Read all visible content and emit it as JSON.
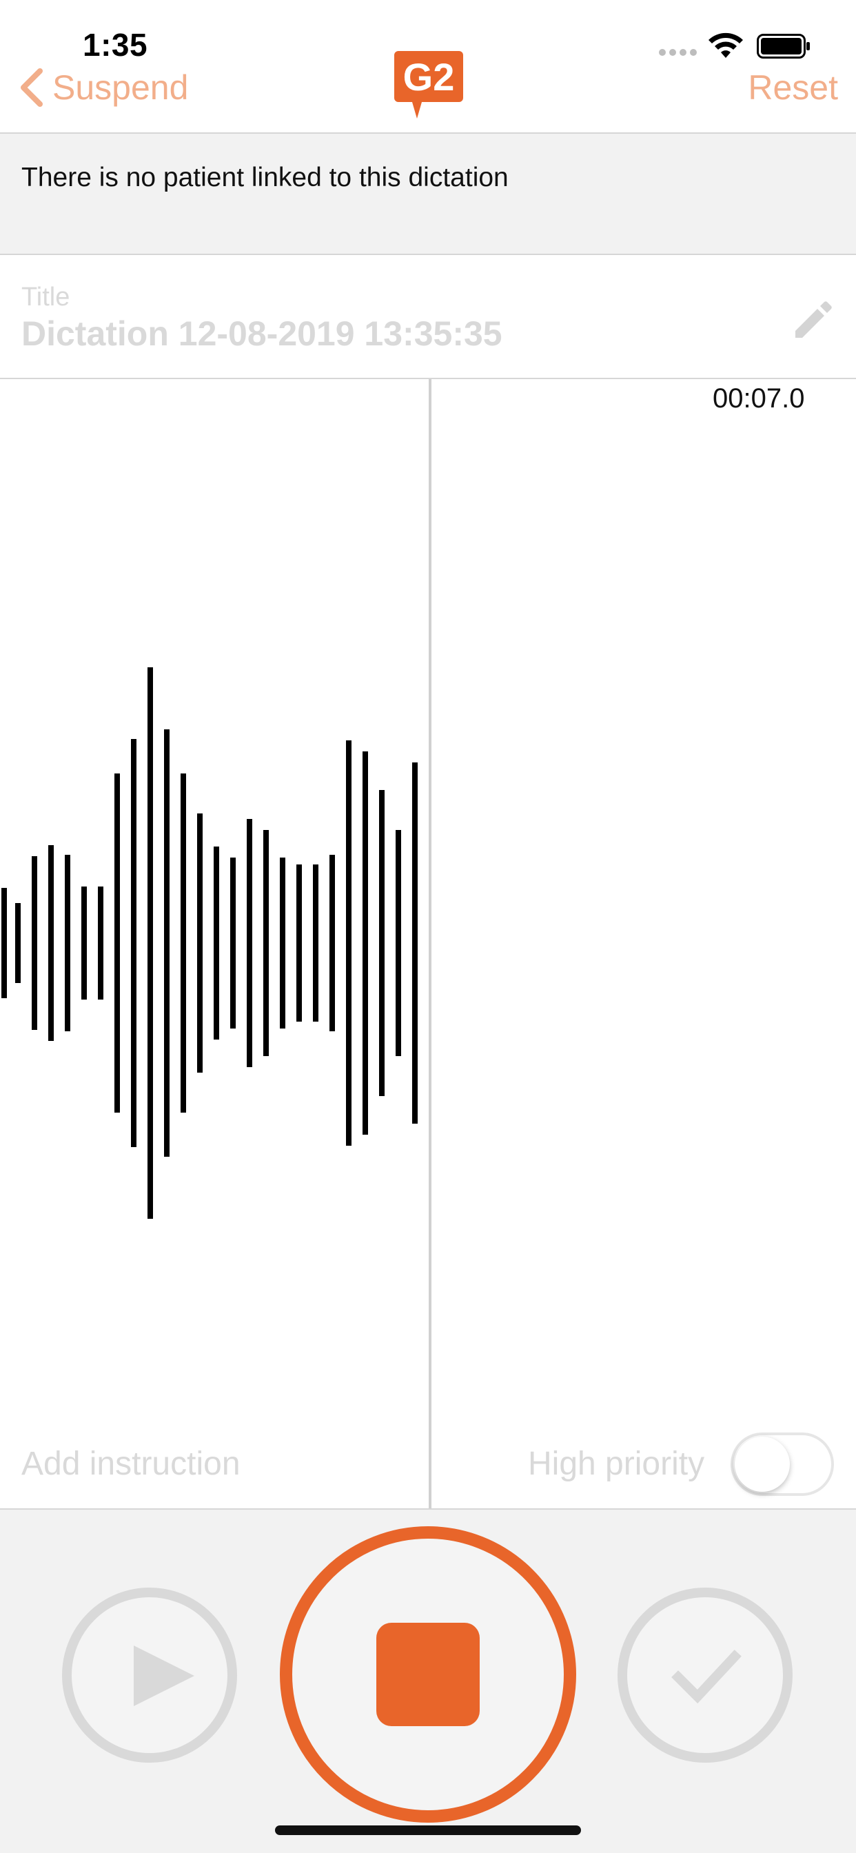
{
  "status_bar": {
    "time": "1:35"
  },
  "nav": {
    "back_label": "Suspend",
    "logo_text": "G2",
    "reset_label": "Reset"
  },
  "patient_banner": {
    "text": "There is no patient linked to this dictation"
  },
  "title_section": {
    "label": "Title",
    "value": "Dictation 12-08-2019 13:35:35"
  },
  "recording": {
    "timer": "00:07.0",
    "add_instruction_label": "Add instruction",
    "high_priority_label": "High priority",
    "high_priority_on": false
  },
  "colors": {
    "accent": "#e8652a",
    "accent_light": "#f2ae8a",
    "disabled": "#d9d9d9",
    "waveform": "#000000"
  },
  "icons": {
    "back": "chevron-left-icon",
    "edit": "pencil-icon",
    "play": "play-icon",
    "stop": "stop-icon",
    "done": "checkmark-icon"
  }
}
